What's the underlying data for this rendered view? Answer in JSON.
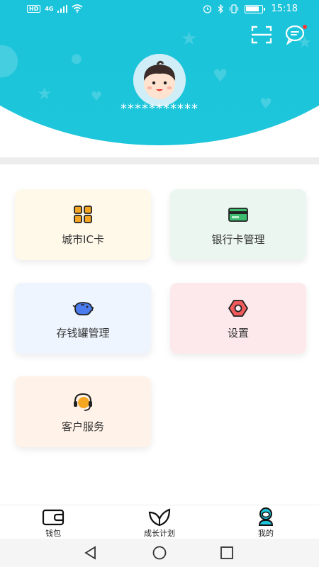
{
  "status_bar": {
    "network_badge": "HD",
    "network_type": "4G",
    "time": "15:18"
  },
  "header": {
    "username": "***********",
    "scan_icon": "scan-icon",
    "message_icon": "message-icon",
    "message_has_unread": true
  },
  "menu": {
    "items": [
      {
        "label": "城市IC卡",
        "icon": "grid-card-icon"
      },
      {
        "label": "银行卡管理",
        "icon": "bank-card-icon"
      },
      {
        "label": "存钱罐管理",
        "icon": "piggy-bank-icon"
      },
      {
        "label": "设置",
        "icon": "settings-icon"
      },
      {
        "label": "客户服务",
        "icon": "headset-icon"
      }
    ]
  },
  "bottom_nav": {
    "items": [
      {
        "label": "钱包",
        "icon": "wallet-icon"
      },
      {
        "label": "成长计划",
        "icon": "leaf-icon"
      },
      {
        "label": "我的",
        "icon": "profile-icon"
      }
    ]
  },
  "colors": {
    "header": "#1ec6db",
    "accent_orange": "#f5a623",
    "accent_blue": "#4a7cf0",
    "accent_red": "#f05a5a",
    "accent_green": "#3dbb6f",
    "unread_dot": "#f03a3a"
  }
}
